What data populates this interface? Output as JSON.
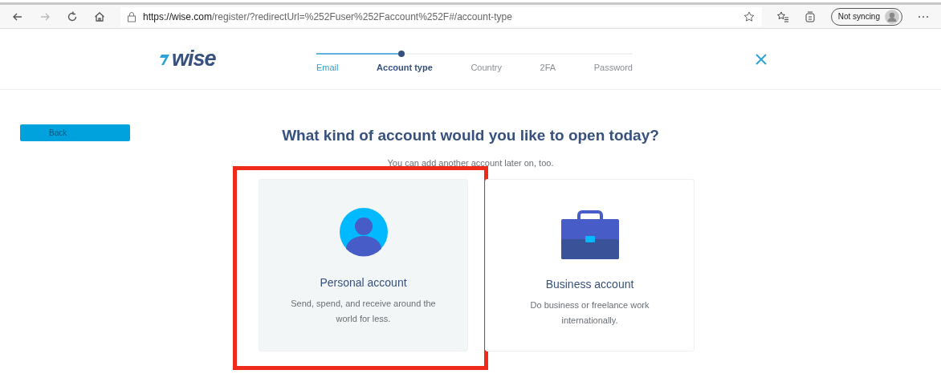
{
  "browser": {
    "url_host": "https://wise.com",
    "url_path": "/register/?redirectUrl=%252Fuser%252Faccount%252F#/account-type",
    "profile": "Not syncing"
  },
  "header": {
    "logo": "wise",
    "progress": {
      "level": 0.27
    },
    "steps": [
      {
        "label": "Email",
        "completed": true,
        "current": false
      },
      {
        "label": "Account type",
        "completed": false,
        "current": true
      },
      {
        "label": "Country",
        "completed": false,
        "current": false
      },
      {
        "label": "2FA",
        "completed": false,
        "current": false
      },
      {
        "label": "Password",
        "completed": false,
        "current": false
      }
    ]
  },
  "back_button": "Back",
  "title": "What kind of account would you like to open today?",
  "subtitle": "You can add another account later on, too.",
  "options": [
    {
      "kind": "personal",
      "title": "Personal account",
      "description": "Send, spend, and receive around the world for less.",
      "selected": true,
      "highlighted": true
    },
    {
      "kind": "business",
      "title": "Business account",
      "description": "Do business or freelance work internationally.",
      "selected": false,
      "highlighted": false
    }
  ]
}
